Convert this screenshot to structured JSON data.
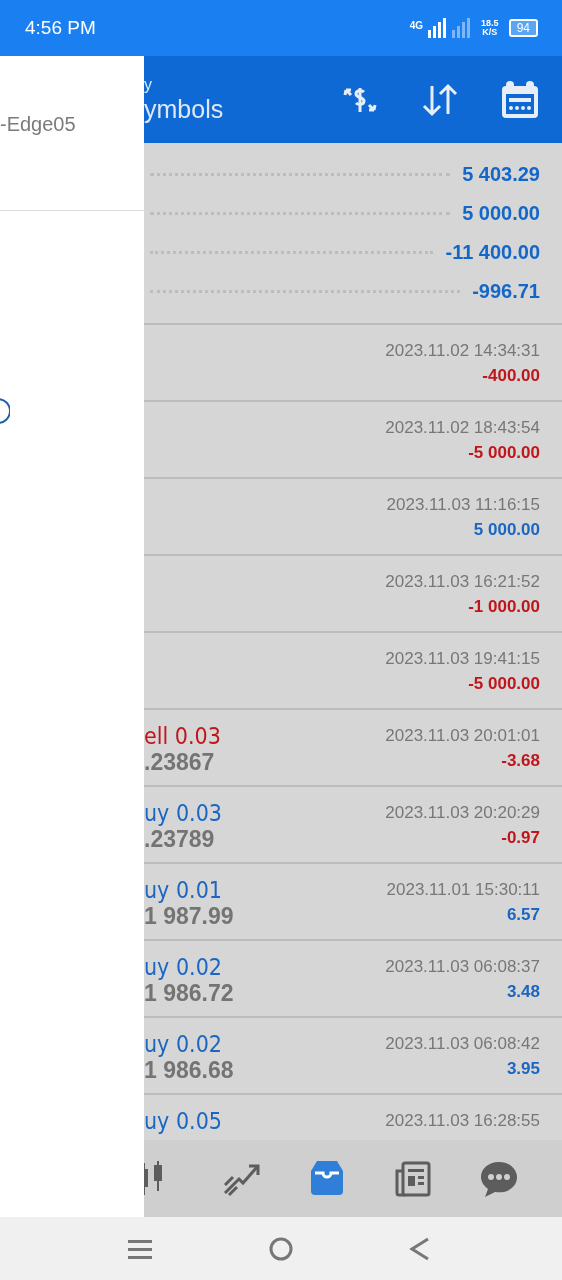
{
  "status_bar": {
    "time": "4:56 PM",
    "network": "4G",
    "speed": "18.5",
    "speed_unit": "K/S",
    "battery": "94"
  },
  "header": {
    "title_top": "y",
    "title": "ymbols"
  },
  "drawer": {
    "account": "-Edge05"
  },
  "summary": [
    "5 403.29",
    "5 000.00",
    "-11 400.00",
    "-996.71"
  ],
  "deals": [
    {
      "date": "2023.11.02 14:34:31",
      "profit": "-400.00",
      "positive": false
    },
    {
      "date": "2023.11.02 18:43:54",
      "profit": "-5 000.00",
      "positive": false
    },
    {
      "date": "2023.11.03 11:16:15",
      "profit": "5 000.00",
      "positive": true
    },
    {
      "date": "2023.11.03 16:21:52",
      "profit": "-1 000.00",
      "positive": false
    },
    {
      "date": "2023.11.03 19:41:15",
      "profit": "-5 000.00",
      "positive": false
    },
    {
      "kind": "sell",
      "type": "ell 0.03",
      "price": ".23867",
      "date": "2023.11.03 20:01:01",
      "profit": "-3.68",
      "positive": false
    },
    {
      "kind": "buy",
      "type": "uy 0.03",
      "price": ".23789",
      "date": "2023.11.03 20:20:29",
      "profit": "-0.97",
      "positive": false
    },
    {
      "kind": "buy",
      "type": "uy 0.01",
      "price": "1 987.99",
      "date": "2023.11.01 15:30:11",
      "profit": "6.57",
      "positive": true
    },
    {
      "kind": "buy",
      "type": "uy 0.02",
      "price": "1 986.72",
      "date": "2023.11.03 06:08:37",
      "profit": "3.48",
      "positive": true
    },
    {
      "kind": "buy",
      "type": "uy 0.02",
      "price": "1 986.68",
      "date": "2023.11.03 06:08:42",
      "profit": "3.95",
      "positive": true
    },
    {
      "kind": "buy",
      "type": "uy 0.05",
      "date": "2023.11.03 16:28:55"
    }
  ],
  "tabs": [
    {
      "kind": "chart",
      "selected": false
    },
    {
      "kind": "trade",
      "selected": false
    },
    {
      "kind": "history",
      "selected": true
    },
    {
      "kind": "news",
      "selected": false
    },
    {
      "kind": "chat",
      "selected": false
    }
  ]
}
